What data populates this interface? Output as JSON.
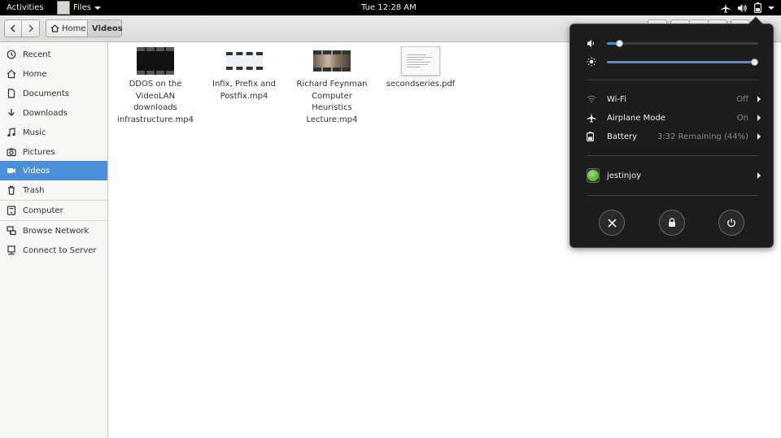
{
  "topbar": {
    "activities": "Activities",
    "app_name": "Files",
    "clock": "Tue 12:28 AM"
  },
  "headerbar": {
    "breadcrumbs": [
      "Home",
      "Videos"
    ]
  },
  "sidebar": {
    "items": [
      {
        "label": "Recent",
        "icon": "clock-icon"
      },
      {
        "label": "Home",
        "icon": "home-icon"
      },
      {
        "label": "Documents",
        "icon": "document-icon"
      },
      {
        "label": "Downloads",
        "icon": "download-icon"
      },
      {
        "label": "Music",
        "icon": "music-icon"
      },
      {
        "label": "Pictures",
        "icon": "camera-icon"
      },
      {
        "label": "Videos",
        "icon": "video-icon",
        "active": true
      },
      {
        "label": "Trash",
        "icon": "trash-icon"
      },
      {
        "label": "Computer",
        "icon": "computer-icon"
      },
      {
        "label": "Browse Network",
        "icon": "network-icon"
      },
      {
        "label": "Connect to Server",
        "icon": "server-icon"
      }
    ]
  },
  "files": [
    {
      "name": "DDOS on the VideoLAN downloads infrastructure.mp4",
      "thumb": "video"
    },
    {
      "name": "Infix, Prefix and Postfix.mp4",
      "thumb": "video"
    },
    {
      "name": "Richard Feynman Computer Heuristics Lecture.mp4",
      "thumb": "video"
    },
    {
      "name": "secondseries.pdf",
      "thumb": "pdf"
    }
  ],
  "system_menu": {
    "volume_level": 0.08,
    "brightness_level": 1.0,
    "wifi": {
      "label": "Wi-Fi",
      "status": "Off"
    },
    "airplane": {
      "label": "Airplane Mode",
      "status": "On"
    },
    "battery": {
      "label": "Battery",
      "status": "3:32 Remaining (44%)"
    },
    "user": {
      "name": "jestinjoy"
    }
  },
  "colors": {
    "accent": "#4a90d9",
    "topbar_bg": "#000000",
    "menu_bg": "#1c1c1c"
  }
}
